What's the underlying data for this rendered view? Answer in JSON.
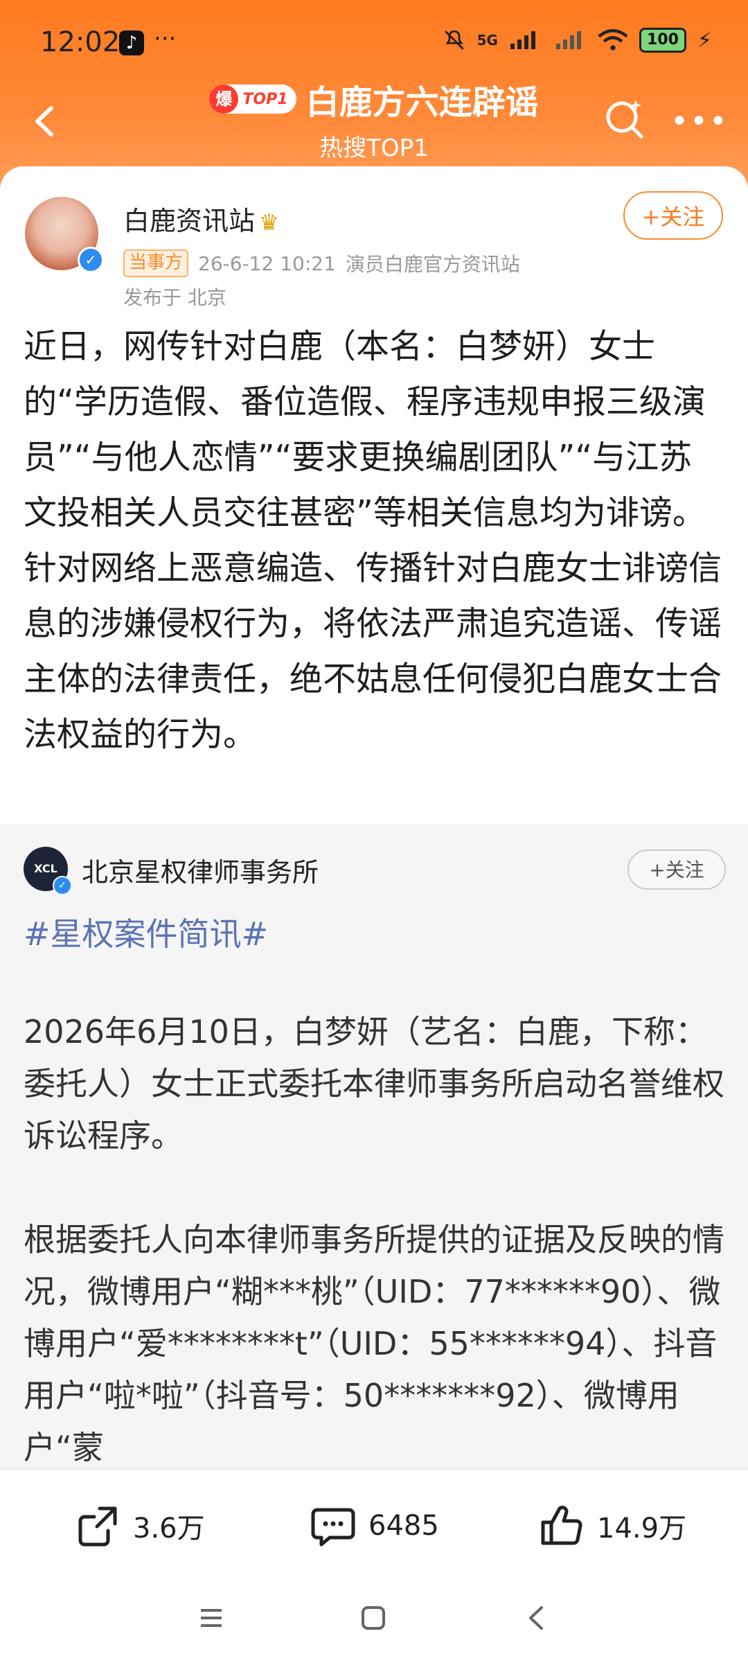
{
  "status_bar": {
    "time": "12:02",
    "network": "5G",
    "battery": "100"
  },
  "header": {
    "badge_char": "爆",
    "badge_text": "TOP1",
    "title": "白鹿方六连辟谣",
    "subtitle": "热搜TOP1"
  },
  "post": {
    "author": "白鹿资讯站",
    "follow_label": "+关注",
    "tag": "当事方",
    "date": "26-6-12 10:21",
    "source": "演员白鹿官方资讯站",
    "location": "发布于 北京",
    "body": "近日，网传针对白鹿（本名：白梦妍）女士的“学历造假、番位造假、程序违规申报三级演员”“与他人恋情”“要求更换编剧团队”“与江苏文投相关人员交往甚密”等相关信息均为诽谤。 针对网络上恶意编造、传播针对白鹿女士诽谤信息的涉嫌侵权行为，将依法严肃追究造谣、传谣主体的法律责任，绝不姑息任何侵犯白鹿女士合法权益的行为。"
  },
  "repost": {
    "author": "北京星权律师事务所",
    "avatar_text": "XCL",
    "follow_label": "+关注",
    "hashtag": "#星权案件简讯#",
    "paragraph1": "2026年6月10日，白梦妍（艺名：白鹿，下称：委托人）女士正式委托本律师事务所启动名誉维权诉讼程序。",
    "paragraph2": "根据委托人向本律师事务所提供的证据及反映的情况，微博用户“糊***桃”（UID：77******90）、微博用户“爱********t”（UID：55******94）、抖音用户“啦*啦”（抖音号：50*******92）、微博用户“蒙"
  },
  "actions": {
    "share": "3.6万",
    "comments": "6485",
    "likes": "14.9万"
  },
  "icons": [
    "tiktok-icon",
    "mute-icon",
    "wifi-icon",
    "back-icon",
    "search-icon",
    "more-icon",
    "verified-icon",
    "crown-icon",
    "share-icon",
    "comment-icon",
    "like-icon",
    "menu-icon",
    "home-icon",
    "nav-back-icon"
  ],
  "colors": {
    "accent": "#ff7a1f",
    "hashtag": "#5b73b3",
    "verified": "#2d8cf0"
  }
}
